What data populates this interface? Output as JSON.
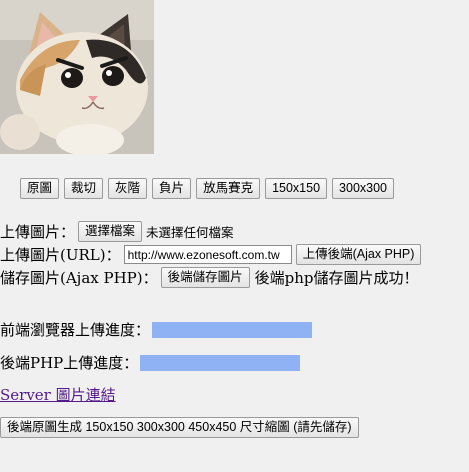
{
  "toolbar": {
    "buttons": [
      "原圖",
      "裁切",
      "灰階",
      "負片",
      "放馬賽克",
      "150x150",
      "300x300"
    ]
  },
  "upload": {
    "label": "上傳圖片：",
    "choose_button": "選擇檔案",
    "no_file_text": "未選擇任何檔案"
  },
  "upload_url": {
    "label": "上傳圖片(URL)：",
    "value": "http://www.ezonesoft.com.tw",
    "button": "上傳後端(Ajax PHP)"
  },
  "save": {
    "label": "儲存圖片(Ajax PHP)：",
    "button": "後端儲存圖片",
    "status": "後端php儲存圖片成功！"
  },
  "progress": {
    "frontend_label": "前端瀏覽器上傳進度：",
    "frontend_value": 1.0,
    "backend_label": "後端PHP上傳進度：",
    "backend_value": 1.0
  },
  "server_link": "Server 圖片連結",
  "generate_button": "後端原圖生成 150x150 300x300 450x450 尺寸縮圖 (請先儲存)",
  "colors": {
    "progress_fill": "#8fb2f5",
    "link": "#551a8b"
  }
}
